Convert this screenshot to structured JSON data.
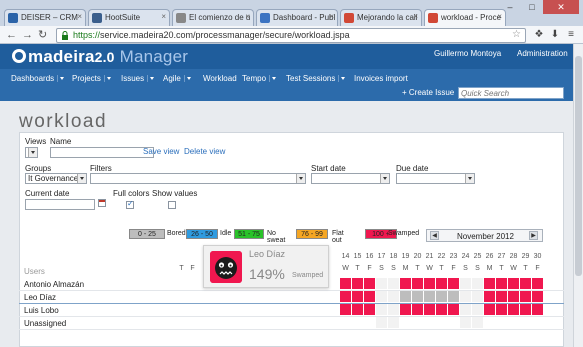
{
  "browser": {
    "tabs": [
      {
        "label": "DEISER – CRM",
        "color": "#2b63a8"
      },
      {
        "label": "HootSuite",
        "color": "#3a5e8c"
      },
      {
        "label": "El comienzo de u",
        "color": "#888888"
      },
      {
        "label": "Dashboard - Publ",
        "color": "#3b73c2"
      },
      {
        "label": "Mejorando la cali",
        "color": "#d14836"
      },
      {
        "label": "workload - Proce",
        "color": "#d14836"
      }
    ],
    "url_scheme": "https://",
    "url_rest": "service.madeira20.com/processmanager/secure/workload.jspa"
  },
  "app": {
    "logo_main": "madeira",
    "logo_ver": "2.0",
    "logo_mgr": " Manager",
    "user": "Guillermo Montoya",
    "admin": "Administration",
    "nav": [
      {
        "label": "Dashboards",
        "caret": true
      },
      {
        "label": "Projects",
        "caret": true
      },
      {
        "label": "Issues",
        "caret": true
      },
      {
        "label": "Agile",
        "caret": true
      },
      {
        "label": "Workload",
        "caret": false
      },
      {
        "label": "Tempo",
        "caret": true
      },
      {
        "label": "Test Sessions",
        "caret": true
      },
      {
        "label": "Invoices import",
        "caret": false
      }
    ],
    "create_issue": "+ Create Issue",
    "quick_search_placeholder": "Quick Search"
  },
  "page": {
    "title": "workload",
    "views_label": "Views",
    "name_label": "Name",
    "save_view": "Save view",
    "delete_view": "Delete view",
    "groups_label": "Groups",
    "groups_value": "It Governance",
    "filters_label": "Filters",
    "start_date_label": "Start date",
    "due_date_label": "Due date",
    "current_date_label": "Current date",
    "full_colors_label": "Full colors",
    "full_colors_checked": true,
    "show_values_label": "Show values",
    "show_values_checked": false
  },
  "legend": [
    {
      "range": "0 - 25",
      "label": "Bored",
      "color": "#bdbdbd"
    },
    {
      "range": "26 - 50",
      "label": "Idle",
      "color": "#2f9be0"
    },
    {
      "range": "51 - 75",
      "label": "No sweat",
      "color": "#29c229"
    },
    {
      "range": "76 - 99",
      "label": "Flat out",
      "color": "#f5a623"
    },
    {
      "range": "100 +",
      "label": "Swamped",
      "color": "#f0174f"
    }
  ],
  "month_label": "November 2012",
  "grid": {
    "users_header": "Users",
    "users": [
      "Antonio Almazán",
      "Leo Díaz",
      "Luis Lobo",
      "Unassigned"
    ],
    "days_visible": [
      {
        "n": "",
        "l": "T"
      },
      {
        "n": "",
        "l": "F"
      },
      {
        "n": "14",
        "l": "W"
      },
      {
        "n": "15",
        "l": "T"
      },
      {
        "n": "16",
        "l": "F"
      },
      {
        "n": "17",
        "l": "S"
      },
      {
        "n": "18",
        "l": "S"
      },
      {
        "n": "19",
        "l": "M"
      },
      {
        "n": "20",
        "l": "T"
      },
      {
        "n": "21",
        "l": "W"
      },
      {
        "n": "22",
        "l": "T"
      },
      {
        "n": "23",
        "l": "F"
      },
      {
        "n": "24",
        "l": "S"
      },
      {
        "n": "25",
        "l": "S"
      },
      {
        "n": "26",
        "l": "M"
      },
      {
        "n": "27",
        "l": "T"
      },
      {
        "n": "28",
        "l": "W"
      },
      {
        "n": "29",
        "l": "T"
      },
      {
        "n": "30",
        "l": "F"
      }
    ]
  },
  "popup": {
    "name": "Leo Díaz",
    "value": "149%",
    "status": "Swamped"
  }
}
